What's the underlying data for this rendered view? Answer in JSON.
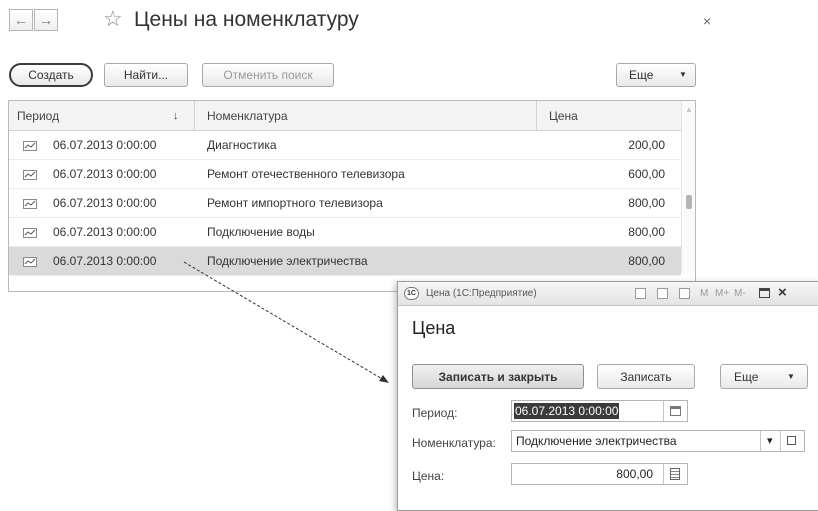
{
  "header": {
    "back_icon": "←",
    "forward_icon": "→",
    "star_icon": "☆",
    "title": "Цены на номенклатуру",
    "close_icon": "×"
  },
  "toolbar": {
    "create_label": "Создать",
    "find_label": "Найти...",
    "cancel_search_label": "Отменить поиск",
    "more_label": "Еще",
    "dropdown_icon": "▼"
  },
  "table": {
    "columns": {
      "period": "Период",
      "sort_icon": "↓",
      "item": "Номенклатура",
      "price": "Цена"
    },
    "rows": [
      {
        "period": "06.07.2013 0:00:00",
        "item": "Диагностика",
        "price": "200,00"
      },
      {
        "period": "06.07.2013 0:00:00",
        "item": "Ремонт отечественного телевизора",
        "price": "600,00"
      },
      {
        "period": "06.07.2013 0:00:00",
        "item": "Ремонт импортного телевизора",
        "price": "800,00"
      },
      {
        "period": "06.07.2013 0:00:00",
        "item": "Подключение воды",
        "price": "800,00"
      },
      {
        "period": "06.07.2013 0:00:00",
        "item": "Подключение электричества",
        "price": "800,00"
      }
    ],
    "selected_row": 4
  },
  "dialog": {
    "window_title": "Цена (1С:Предприятие)",
    "logo_text": "1С",
    "memory_labels": [
      "M",
      "M+",
      "M-"
    ],
    "heading": "Цена",
    "save_close_label": "Записать и закрыть",
    "save_label": "Записать",
    "more_label": "Еще",
    "dropdown_icon": "▼",
    "period_label": "Период:",
    "period_value": "06.07.2013  0:00:00",
    "item_label": "Номенклатура:",
    "item_value": "Подключение электричества",
    "item_dropdown_icon": "▾",
    "price_label": "Цена:",
    "price_value": "800,00"
  },
  "colors": {
    "selected_row": "#dadada",
    "header_bg": "#f3f3f3",
    "border": "#b9b9b9"
  }
}
